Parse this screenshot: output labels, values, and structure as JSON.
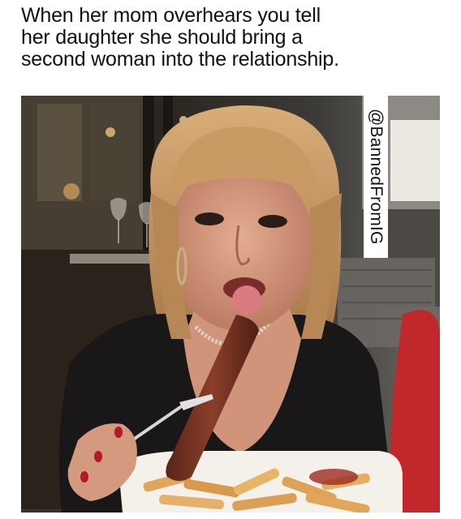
{
  "meme": {
    "caption_lines": [
      "When her mom overhears you tell",
      "her daughter she should bring a",
      "second woman into the relationship."
    ],
    "watermark": "@BannedFromIG"
  },
  "photo": {
    "subject": "blonde-bob-woman-with-sausage-and-fries",
    "colors": {
      "background_dark": "#2a2520",
      "hair": "#c89a62",
      "skin": "#d9a184",
      "jacket": "#1a1718",
      "sausage": "#7a3424",
      "fries": "#e0a75a",
      "plate": "#f4f1ea",
      "red_sleeve": "#c0282c",
      "nails": "#b01a2a"
    }
  }
}
